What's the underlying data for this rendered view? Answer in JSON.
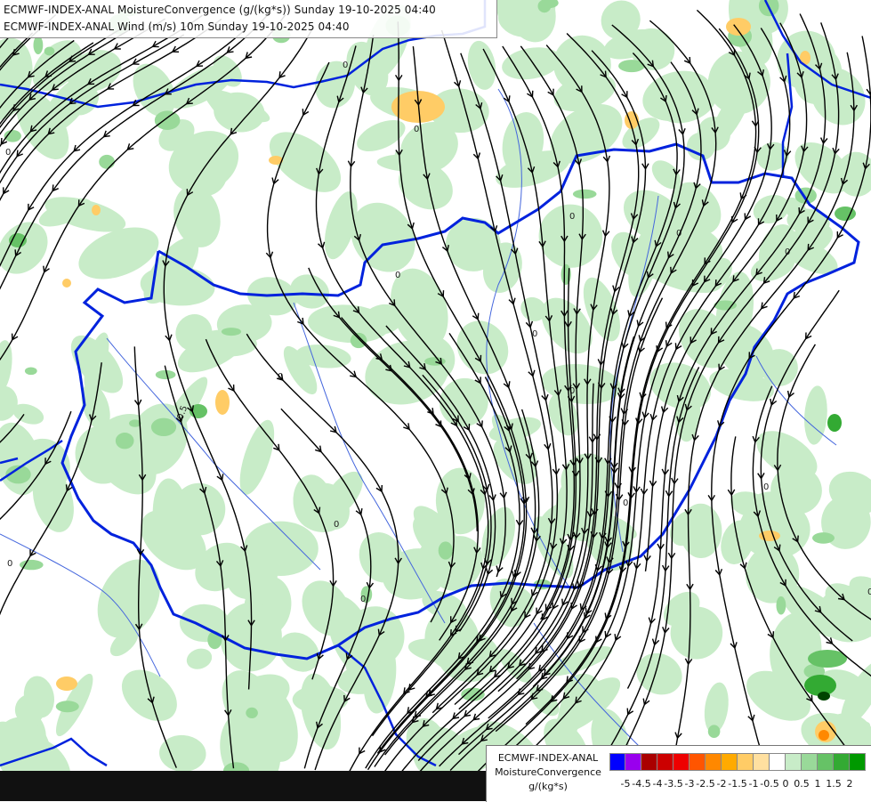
{
  "title": {
    "line1": "ECMWF-INDEX-ANAL MoistureConvergence (g/(kg*s)) Sunday 19-10-2025 04:40",
    "line2": "ECMWF-INDEX-ANAL Wind (m/s) 10m Sunday 19-10-2025 04:40"
  },
  "legend": {
    "line1": "ECMWF-INDEX-ANAL",
    "line2": "MoistureConvergence",
    "line3": "g/(kg*s)",
    "swatch_colors": [
      "#0000ff",
      "#9900ee",
      "#aa0000",
      "#cc0000",
      "#ee0000",
      "#ff5500",
      "#ff8800",
      "#ffaa00",
      "#ffcc66",
      "#ffe0a0",
      "#ffffff",
      "#c8ecc8",
      "#99d999",
      "#66c266",
      "#33aa33",
      "#009900"
    ],
    "tick_labels": [
      "-5",
      "-4.5",
      "-4",
      "-3.5",
      "-3",
      "-2.5",
      "-2",
      "-1.5",
      "-1",
      "-0.5",
      "0",
      "0.5",
      "1",
      "1.5",
      "2"
    ]
  },
  "map": {
    "contour_label": "0",
    "contour_label_alt": "0.5",
    "colors": {
      "background": "#ffffff",
      "light_green": "#c8ecc8",
      "mid_green": "#99d999",
      "dark_green": "#33aa33",
      "orange": "#ffcc66",
      "border": "#0022dd",
      "river": "#4466dd",
      "streamline": "#000000"
    },
    "layers": [
      "moisture-convergence-shading",
      "country-borders",
      "rivers",
      "wind-streamlines"
    ]
  }
}
